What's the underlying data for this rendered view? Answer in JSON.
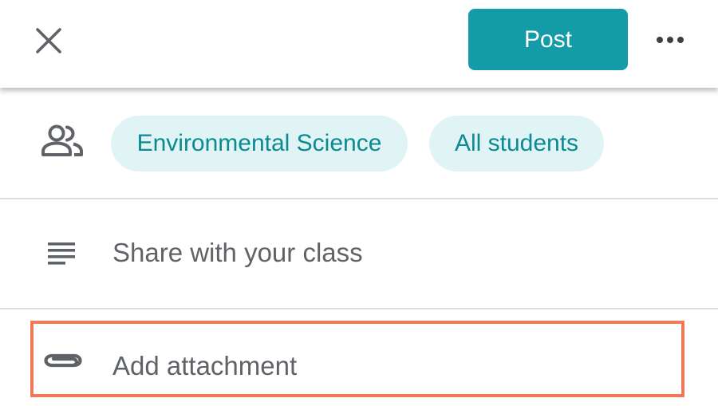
{
  "colors": {
    "accent": "#139ba7",
    "chip_bg": "#e0f4f6",
    "chip_text": "#0b8a92",
    "icon_gray": "#5f6368",
    "highlight": "#f07a55"
  },
  "header": {
    "close_icon": "close-icon",
    "post_label": "Post",
    "more_icon": "more-horizontal-icon"
  },
  "audience": {
    "icon": "people-icon",
    "class_chip": "Environmental Science",
    "students_chip": "All students"
  },
  "share": {
    "icon": "notes-icon",
    "placeholder": "Share with your class"
  },
  "attachment": {
    "icon": "paperclip-icon",
    "label": "Add attachment"
  }
}
